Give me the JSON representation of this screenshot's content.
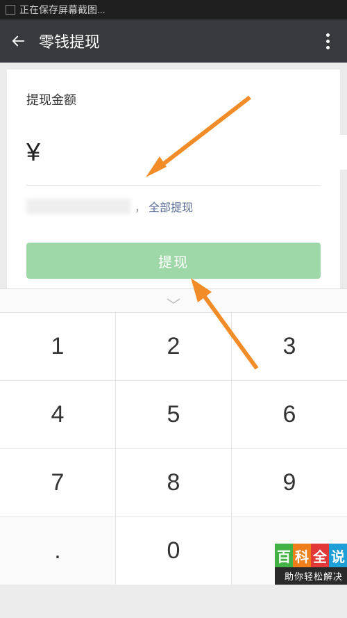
{
  "status_bar": {
    "text": "正在保存屏幕截图..."
  },
  "header": {
    "title": "零钱提现"
  },
  "form": {
    "label": "提现金额",
    "currency": "¥",
    "comma": "，",
    "withdraw_all": "全部提现",
    "submit": "提现"
  },
  "keypad": {
    "r1": [
      "1",
      "2",
      "3"
    ],
    "r2": [
      "4",
      "5",
      "6"
    ],
    "r3": [
      "7",
      "8",
      "9"
    ],
    "r4_dot": ".",
    "r4_zero": "0"
  },
  "watermark": {
    "chars": [
      "百",
      "科",
      "全",
      "说"
    ],
    "sub": "助你轻松解决"
  }
}
